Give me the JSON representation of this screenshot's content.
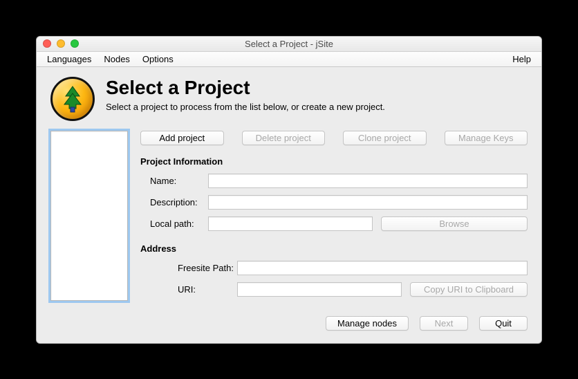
{
  "window": {
    "title": "Select a Project - jSite"
  },
  "menu": {
    "languages": "Languages",
    "nodes": "Nodes",
    "options": "Options",
    "help": "Help"
  },
  "header": {
    "title": "Select a Project",
    "subtitle": "Select a project to process from the list below, or create a new project."
  },
  "buttons": {
    "add_project": "Add project",
    "delete_project": "Delete project",
    "clone_project": "Clone project",
    "manage_keys": "Manage Keys",
    "browse": "Browse",
    "copy_uri": "Copy URI to Clipboard",
    "manage_nodes": "Manage nodes",
    "next": "Next",
    "quit": "Quit"
  },
  "sections": {
    "project_info": "Project Information",
    "address": "Address"
  },
  "fields": {
    "name_label": "Name:",
    "name_value": "",
    "description_label": "Description:",
    "description_value": "",
    "localpath_label": "Local path:",
    "localpath_value": "",
    "freesite_label": "Freesite Path:",
    "freesite_value": "",
    "uri_label": "URI:",
    "uri_value": ""
  }
}
